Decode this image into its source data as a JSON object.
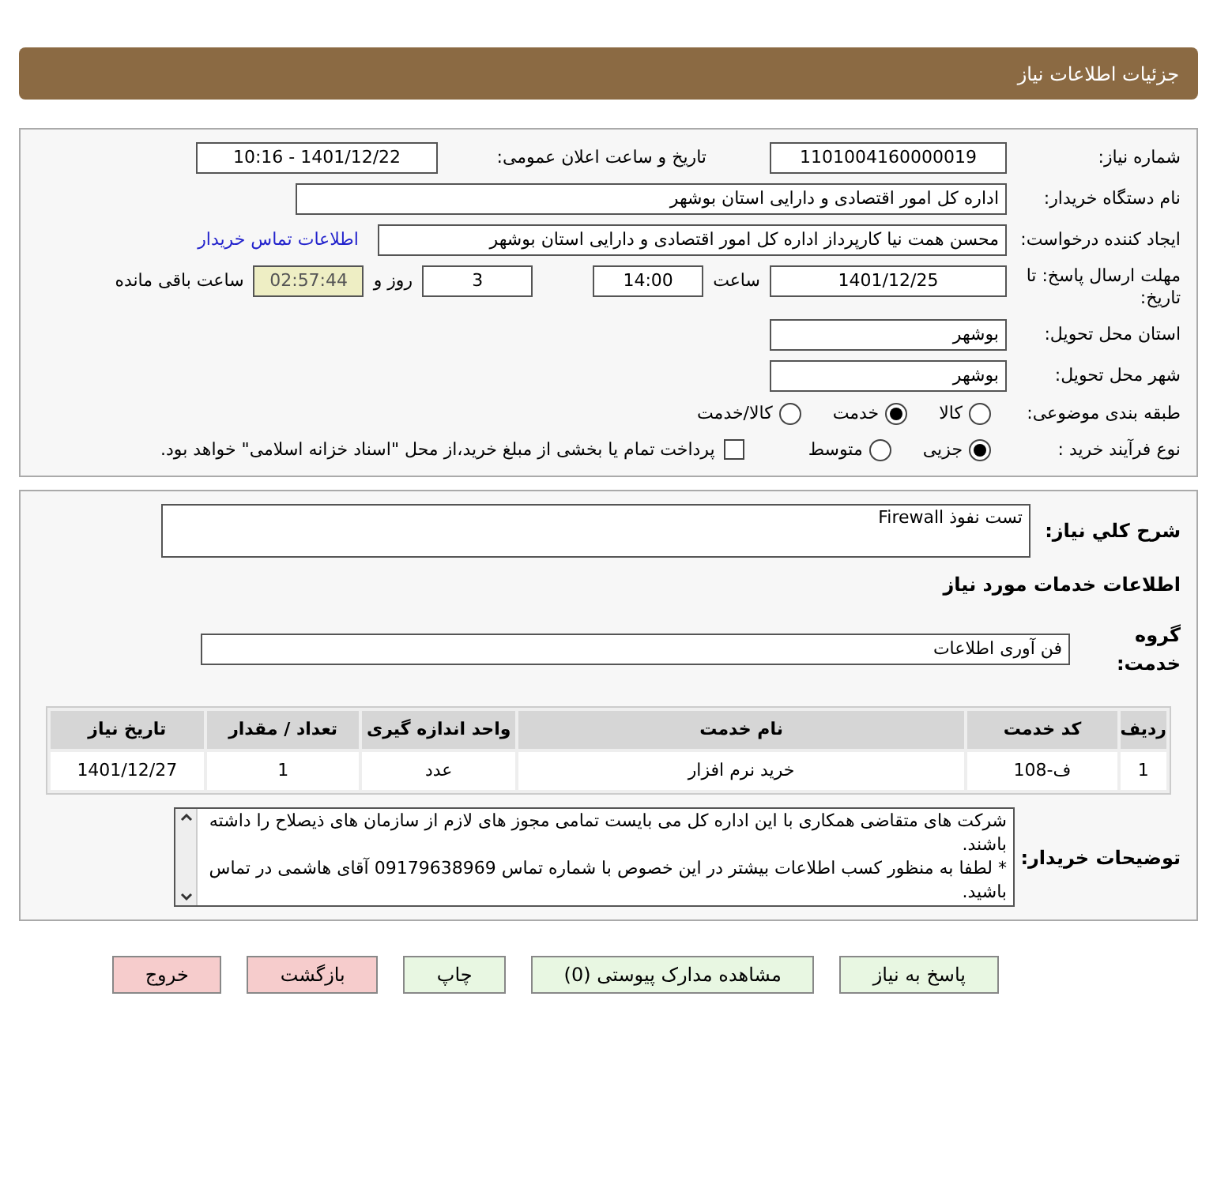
{
  "header": {
    "title": "جزئیات اطلاعات نیاز"
  },
  "details": {
    "need_number": {
      "label": "شماره نیاز:",
      "value": "1101004160000019"
    },
    "announce": {
      "label": "تاریخ و ساعت اعلان عمومی:",
      "value": "1401/12/22 - 10:16"
    },
    "buyer_org": {
      "label": "نام دستگاه خریدار:",
      "value": "اداره کل امور اقتصادی و دارایی استان بوشهر"
    },
    "requester": {
      "label": "ایجاد کننده درخواست:",
      "value": "محسن همت نیا کارپرداز اداره کل امور اقتصادی و دارایی استان بوشهر",
      "link": "اطلاعات تماس خریدار"
    },
    "deadline": {
      "label": "مهلت ارسال پاسخ: تا تاریخ:",
      "date": "1401/12/25",
      "time_label": "ساعت",
      "time": "14:00",
      "days": "3",
      "days_label": "روز و",
      "remaining": "02:57:44",
      "remaining_label": "ساعت باقی مانده"
    },
    "province": {
      "label": "استان محل تحویل:",
      "value": "بوشهر"
    },
    "city": {
      "label": "شهر محل تحویل:",
      "value": "بوشهر"
    },
    "category": {
      "label": "طبقه بندی موضوعی:",
      "options": [
        {
          "label": "کالا",
          "selected": false
        },
        {
          "label": "خدمت",
          "selected": true
        },
        {
          "label": "کالا/خدمت",
          "selected": false
        }
      ]
    },
    "process": {
      "label": "نوع فرآیند خرید :",
      "options": [
        {
          "label": "جزیی",
          "selected": true
        },
        {
          "label": "متوسط",
          "selected": false
        }
      ],
      "checkbox": {
        "label": "پرداخت تمام یا بخشی از مبلغ خرید،از محل \"اسناد خزانه اسلامی\" خواهد بود.",
        "checked": false
      }
    }
  },
  "description": {
    "label": "شرح کلي نياز:",
    "value": "تست نفوذ Firewall"
  },
  "services_title": "اطلاعات خدمات مورد نیاز",
  "service_group": {
    "label": "گروه خدمت:",
    "value": "فن آوری اطلاعات"
  },
  "table": {
    "columns": [
      "ردیف",
      "کد خدمت",
      "نام خدمت",
      "واحد اندازه گیری",
      "تعداد / مقدار",
      "تاریخ نیاز"
    ],
    "rows": [
      [
        "1",
        "ف-108",
        "خرید نرم افزار",
        "عدد",
        "1",
        "1401/12/27"
      ]
    ]
  },
  "buyer_notes": {
    "label": "توضیحات خریدار:",
    "text": "شرکت های متقاضی همکاری با این اداره کل می بایست تمامی مجوز های لازم از سازمان های ذیصلاح را داشته باشند.\n* لطفا به منظور کسب اطلاعات بیشتر در این خصوص با شماره تماس 09179638969 آقای هاشمی در تماس باشید."
  },
  "buttons": [
    {
      "label": "پاسخ به نیاز",
      "kind": "normal"
    },
    {
      "label": "مشاهده مدارک پیوستی (0)",
      "kind": "normal"
    },
    {
      "label": "چاپ",
      "kind": "normal"
    },
    {
      "label": "بازگشت",
      "kind": "danger"
    },
    {
      "label": "خروج",
      "kind": "danger"
    }
  ]
}
